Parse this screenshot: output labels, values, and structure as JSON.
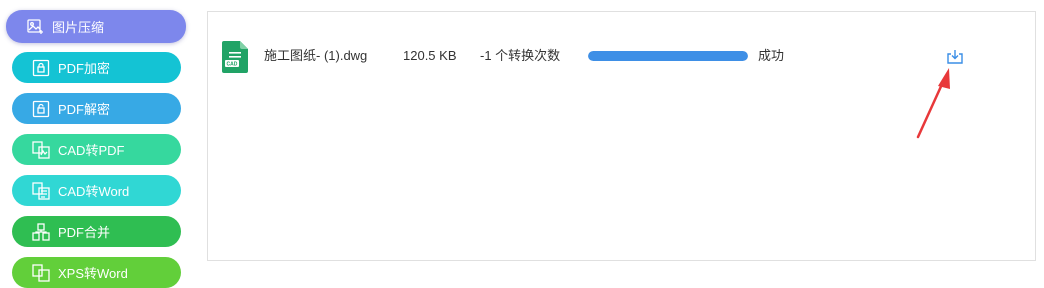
{
  "sidebar": {
    "items": [
      {
        "label": "图片压缩",
        "icon": "image-compress-icon",
        "color": "#7d87ec",
        "active": true
      },
      {
        "label": "PDF加密",
        "icon": "pdf-lock-icon",
        "color": "#14c3d4"
      },
      {
        "label": "PDF解密",
        "icon": "pdf-unlock-icon",
        "color": "#37a9e5"
      },
      {
        "label": "CAD转PDF",
        "icon": "cad-to-pdf-icon",
        "color": "#36d89e"
      },
      {
        "label": "CAD转Word",
        "icon": "cad-to-word-icon",
        "color": "#30d7d4"
      },
      {
        "label": "PDF合并",
        "icon": "pdf-merge-icon",
        "color": "#2fbe52"
      },
      {
        "label": "XPS转Word",
        "icon": "xps-to-word-icon",
        "color": "#62cf3a"
      }
    ]
  },
  "file": {
    "icon_label": "CAD",
    "name": "施工图纸- (1).dwg",
    "size": "120.5 KB",
    "remaining": "-1 个转换次数",
    "progress": 1.0,
    "status": "成功",
    "download_icon": "download-icon"
  },
  "colors": {
    "progress": "#3e8fe6",
    "file_icon": "#21a366",
    "arrow": "#e8383a",
    "download": "#3a8ee6"
  }
}
